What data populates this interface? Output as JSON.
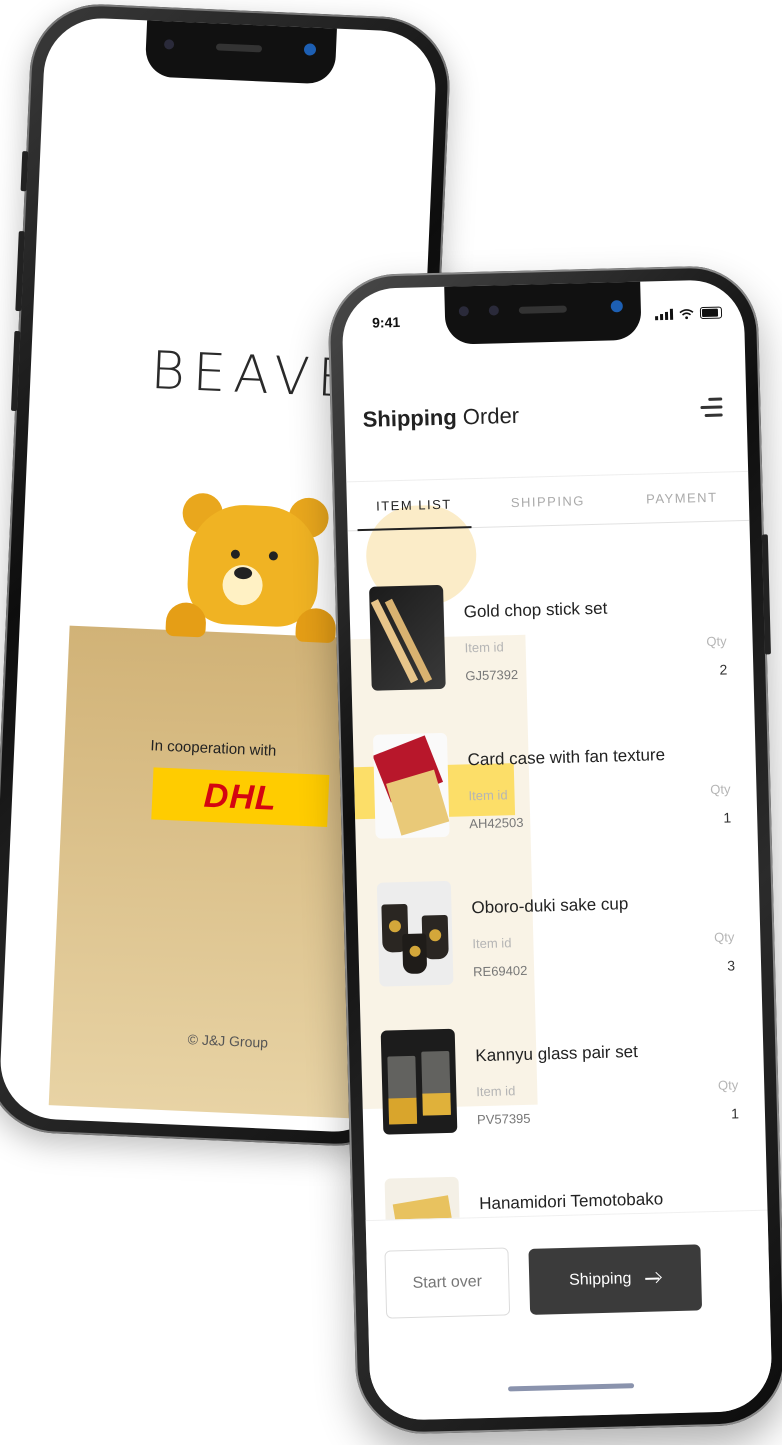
{
  "back_phone": {
    "logo": "BEAVER",
    "cooperation_text": "In cooperation with",
    "partner_logo": "DHL",
    "copyright": "© J&J Group"
  },
  "status": {
    "time": "9:41"
  },
  "header": {
    "title_bold": "Shipping",
    "title_rest": " Order"
  },
  "tabs": [
    {
      "label": "ITEM LIST",
      "active": true
    },
    {
      "label": "SHIPPING",
      "active": false
    },
    {
      "label": "PAYMENT",
      "active": false
    }
  ],
  "labels": {
    "item_id": "Item id",
    "qty": "Qty"
  },
  "items": [
    {
      "name": "Gold chop stick set",
      "id": "GJ57392",
      "qty": "2"
    },
    {
      "name": "Card case with fan texture",
      "id": "AH42503",
      "qty": "1"
    },
    {
      "name": "Oboro-duki sake cup",
      "id": "RE69402",
      "qty": "3"
    },
    {
      "name": "Kannyu glass pair set",
      "id": "PV57395",
      "qty": "1"
    },
    {
      "name": "Hanamidori Temotobako",
      "id": "",
      "qty": ""
    }
  ],
  "buttons": {
    "start_over": "Start over",
    "shipping": "Shipping"
  },
  "colors": {
    "accent_dark": "#3b3b3b",
    "brand_yellow": "#f0b323",
    "dhl_red": "#d40511",
    "dhl_yellow": "#ffcc00"
  }
}
